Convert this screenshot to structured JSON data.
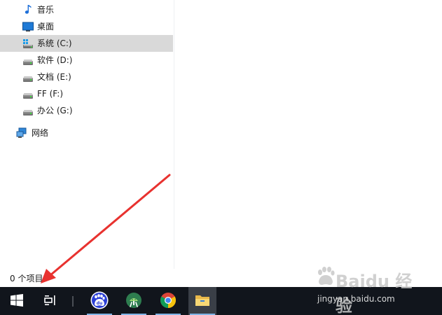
{
  "nav": {
    "items": [
      {
        "label": "音乐",
        "icon": "music-note-icon"
      },
      {
        "label": "桌面",
        "icon": "desktop-icon"
      },
      {
        "label": "系统 (C:)",
        "icon": "windows-drive-icon",
        "selected": true
      },
      {
        "label": "软件 (D:)",
        "icon": "drive-icon"
      },
      {
        "label": "文档 (E:)",
        "icon": "drive-icon"
      },
      {
        "label": "FF (F:)",
        "icon": "drive-icon"
      },
      {
        "label": "办公 (G:)",
        "icon": "drive-icon"
      },
      {
        "label": "网络",
        "icon": "network-icon"
      }
    ]
  },
  "status": {
    "item_count": "0 个项目"
  },
  "taskbar": {
    "buttons": [
      {
        "name": "start-button",
        "icon": "windows-logo-icon"
      },
      {
        "name": "task-view-button",
        "icon": "task-view-icon"
      },
      {
        "name": "baidu-app",
        "icon": "baidu-paw-icon"
      },
      {
        "name": "android-studio-app",
        "icon": "android-studio-icon"
      },
      {
        "name": "chrome-app",
        "icon": "chrome-icon"
      },
      {
        "name": "file-explorer-app",
        "icon": "folder-icon",
        "active": true
      }
    ]
  },
  "watermark": {
    "brand": "Baidu 经验",
    "url": "jingyan.baidu.com"
  },
  "colors": {
    "selection": "#d9d9d9",
    "taskbar": "#11151c",
    "annotation_arrow": "#e8322f",
    "music_icon": "#1e6fd9"
  }
}
